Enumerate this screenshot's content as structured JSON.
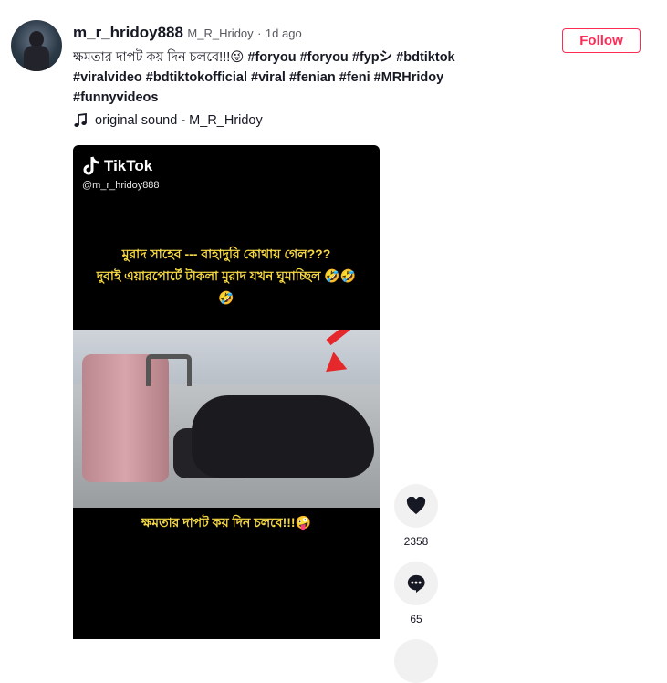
{
  "post": {
    "username": "m_r_hridoy888",
    "nickname": "M_R_Hridoy",
    "separator": "·",
    "time": "1d ago",
    "desc_text": "ক্ষমতার দাপট কয় দিন চলবে!!!😜",
    "hashtags": [
      "#foryou",
      "#foryou",
      "#fypシ",
      "#bdtiktok",
      "#viralvideo",
      "#bdtiktokofficial",
      "#viral",
      "#fenian",
      "#feni",
      "#MRHridoy",
      "#funnyvideos"
    ],
    "music_icon": "music-note-icon",
    "music": "original sound - M_R_Hridoy",
    "follow_label": "Follow"
  },
  "video": {
    "logo_text": "TikTok",
    "handle": "@m_r_hridoy888",
    "overlay_line1": "মুরাদ সাহেব --- বাহাদুরি কোথায় গেল???",
    "overlay_line2": "দুবাই এয়ারপোর্টে টাকলা মুরাদ যখন ঘুমাচ্ছিল 🤣🤣🤣",
    "overlay_bottom": "ক্ষমতার দাপট কয় দিন চলবে!!!🤪"
  },
  "actions": {
    "like_count": "2358",
    "comment_count": "65"
  },
  "colors": {
    "follow": "#fe2c55",
    "overlay_text": "#f5d742"
  }
}
